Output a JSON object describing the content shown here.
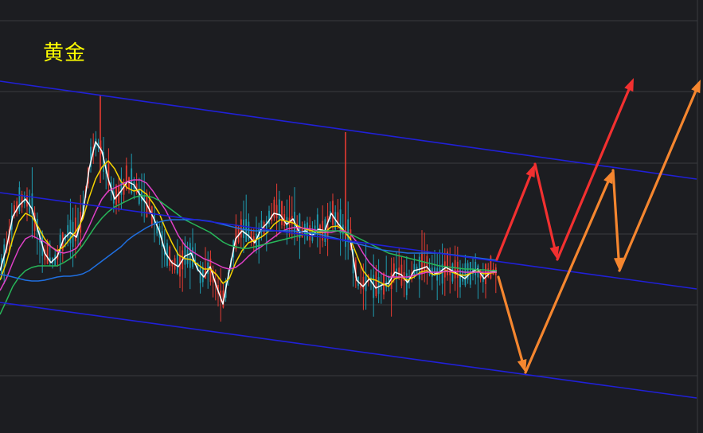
{
  "title": "黄金",
  "colors": {
    "background": "#1c1d21",
    "grid": "#3a3b40",
    "up": "#e53b32",
    "down": "#1e9bb0",
    "title": "#ffff00",
    "channel": "#2020d8",
    "arrow_red": "#f23030",
    "arrow_orange": "#f5862f"
  },
  "chart_data": {
    "type": "candlestick",
    "title": "黄金",
    "grid": true,
    "ylim": [
      0,
      544
    ],
    "series": [
      {
        "name": "",
        "color": "#ffffff",
        "kind": "ma",
        "x": [
          0,
          8,
          16,
          24,
          32,
          40,
          48,
          56,
          64,
          72,
          80,
          88,
          96,
          104,
          112,
          120,
          128,
          136,
          144,
          152,
          160,
          168,
          176,
          184,
          192,
          200,
          208,
          216,
          224,
          232,
          240,
          248,
          256,
          264,
          272,
          280,
          288,
          296,
          304,
          312,
          320,
          328,
          336,
          344,
          352,
          360,
          368,
          376,
          384,
          392,
          400,
          408,
          416,
          424,
          432,
          440,
          448,
          456,
          464,
          472,
          480,
          488,
          496,
          504,
          512,
          520,
          528,
          536,
          544,
          552,
          560,
          568,
          576,
          584,
          592,
          600,
          608,
          616,
          624
        ],
        "y": [
          340,
          312,
          272,
          258,
          250,
          262,
          290,
          318,
          330,
          322,
          300,
          292,
          298,
          270,
          212,
          178,
          190,
          225,
          250,
          240,
          228,
          232,
          245,
          256,
          272,
          290,
          318,
          330,
          335,
          322,
          318,
          338,
          348,
          335,
          360,
          382,
          340,
          300,
          290,
          296,
          305,
          288,
          280,
          268,
          270,
          282,
          275,
          292,
          290,
          296,
          288,
          290,
          268,
          280,
          290,
          300,
          352,
          360,
          350,
          362,
          358,
          356,
          342,
          345,
          355,
          340,
          338,
          335,
          345,
          342,
          336,
          340,
          345,
          350,
          342,
          338,
          350,
          342,
          340
        ]
      },
      {
        "name": "",
        "color": "#f5d300",
        "kind": "ma",
        "x": [
          0,
          8,
          16,
          24,
          32,
          40,
          48,
          56,
          64,
          72,
          80,
          88,
          96,
          104,
          112,
          120,
          128,
          136,
          144,
          152,
          160,
          168,
          176,
          184,
          192,
          200,
          208,
          216,
          224,
          232,
          240,
          248,
          256,
          264,
          272,
          280,
          288,
          296,
          304,
          312,
          320,
          328,
          336,
          344,
          352,
          360,
          368,
          376,
          384,
          392,
          400,
          408,
          416,
          424,
          432,
          440,
          448,
          456,
          464,
          472,
          480,
          488,
          496,
          504,
          512,
          520,
          528,
          536,
          544,
          552,
          560,
          568,
          576,
          584,
          592,
          600,
          608,
          616,
          624
        ],
        "y": [
          352,
          330,
          300,
          278,
          268,
          272,
          285,
          300,
          310,
          315,
          310,
          300,
          290,
          275,
          248,
          225,
          210,
          202,
          212,
          228,
          236,
          240,
          238,
          244,
          255,
          268,
          288,
          305,
          320,
          325,
          326,
          332,
          338,
          338,
          345,
          356,
          350,
          330,
          315,
          305,
          302,
          298,
          292,
          282,
          276,
          278,
          280,
          285,
          288,
          290,
          292,
          292,
          285,
          284,
          290,
          300,
          320,
          340,
          350,
          352,
          356,
          360,
          350,
          348,
          352,
          348,
          342,
          340,
          345,
          344,
          340,
          342,
          345,
          346,
          343,
          341,
          344,
          343,
          342
        ]
      },
      {
        "name": "",
        "color": "#e040c8",
        "kind": "ma",
        "x": [
          0,
          8,
          16,
          24,
          32,
          40,
          48,
          56,
          64,
          72,
          80,
          88,
          96,
          104,
          112,
          120,
          128,
          136,
          144,
          152,
          160,
          168,
          176,
          184,
          192,
          200,
          208,
          216,
          224,
          232,
          240,
          248,
          256,
          264,
          272,
          280,
          288,
          296,
          304,
          312,
          320,
          328,
          336,
          344,
          352,
          360,
          368,
          376,
          384,
          392,
          400,
          408,
          416,
          424,
          432,
          440,
          448,
          456,
          464,
          472,
          480,
          488,
          496,
          504,
          512,
          520,
          528,
          536,
          544,
          552,
          560,
          568,
          576,
          584,
          592,
          600,
          608,
          616,
          624
        ],
        "y": [
          365,
          350,
          330,
          312,
          300,
          296,
          300,
          304,
          310,
          316,
          318,
          316,
          312,
          300,
          284,
          266,
          250,
          240,
          236,
          232,
          228,
          226,
          226,
          230,
          240,
          252,
          264,
          280,
          296,
          308,
          315,
          320,
          325,
          328,
          332,
          336,
          338,
          336,
          330,
          322,
          315,
          310,
          304,
          298,
          292,
          288,
          286,
          286,
          287,
          288,
          290,
          292,
          292,
          290,
          290,
          294,
          304,
          318,
          330,
          338,
          344,
          348,
          348,
          348,
          348,
          346,
          344,
          342,
          342,
          342,
          341,
          341,
          341,
          342,
          342,
          342,
          342,
          342,
          342
        ]
      },
      {
        "name": "",
        "color": "#27b85a",
        "kind": "ma",
        "x": [
          0,
          8,
          16,
          24,
          32,
          40,
          48,
          56,
          64,
          72,
          80,
          88,
          96,
          104,
          112,
          120,
          128,
          136,
          144,
          152,
          160,
          168,
          176,
          184,
          192,
          200,
          208,
          216,
          224,
          232,
          240,
          248,
          256,
          264,
          272,
          280,
          288,
          296,
          304,
          312,
          320,
          328,
          336,
          344,
          352,
          360,
          368,
          376,
          384,
          392,
          400,
          408,
          416,
          424,
          432,
          440,
          448,
          456,
          464,
          472,
          480,
          488,
          496,
          504,
          512,
          520,
          528,
          536,
          544,
          552,
          560,
          568,
          576,
          584,
          592,
          600,
          608,
          616,
          624
        ],
        "y": [
          395,
          378,
          360,
          348,
          340,
          336,
          334,
          334,
          334,
          334,
          330,
          325,
          318,
          308,
          296,
          284,
          274,
          266,
          260,
          256,
          252,
          248,
          246,
          246,
          248,
          252,
          258,
          264,
          270,
          276,
          280,
          284,
          288,
          292,
          298,
          304,
          308,
          310,
          312,
          312,
          310,
          308,
          306,
          304,
          302,
          300,
          298,
          296,
          294,
          292,
          290,
          290,
          290,
          290,
          292,
          294,
          298,
          302,
          306,
          310,
          314,
          318,
          320,
          322,
          324,
          326,
          328,
          330,
          332,
          334,
          335,
          336,
          337,
          338,
          338,
          339,
          339,
          340,
          340
        ]
      },
      {
        "name": "",
        "color": "#1f6fe0",
        "kind": "ma",
        "x": [
          0,
          8,
          16,
          24,
          32,
          40,
          48,
          56,
          64,
          72,
          80,
          88,
          96,
          104,
          112,
          120,
          128,
          136,
          144,
          152,
          160,
          168,
          176,
          184,
          192,
          200,
          208,
          216,
          224,
          232,
          240,
          248,
          256,
          264,
          272,
          280,
          288,
          296,
          304,
          312,
          320,
          328,
          336,
          344,
          352,
          360,
          368,
          376,
          384,
          392,
          400,
          408,
          416,
          424,
          432,
          440,
          448,
          456,
          464,
          472,
          480,
          488,
          496,
          504,
          512,
          520,
          528,
          536,
          544,
          552,
          560,
          568,
          576,
          584,
          592,
          600,
          608,
          616,
          624
        ],
        "y": [
          345,
          346,
          348,
          350,
          352,
          353,
          353,
          352,
          350,
          348,
          347,
          347,
          346,
          344,
          340,
          334,
          328,
          322,
          316,
          310,
          302,
          296,
          291,
          286,
          282,
          279,
          277,
          276,
          276,
          276,
          276,
          276,
          277,
          278,
          280,
          282,
          284,
          286,
          288,
          289,
          290,
          290,
          290,
          290,
          290,
          290,
          290,
          291,
          292,
          293,
          294,
          296,
          298,
          300,
          302,
          304,
          306,
          308,
          310,
          312,
          314,
          315,
          316,
          317,
          318,
          318,
          318,
          318,
          318,
          318,
          319,
          320,
          321,
          322,
          323,
          324,
          325,
          326,
          327
        ]
      }
    ],
    "channels": [
      {
        "name": "upper",
        "x": [
          0,
          875
        ],
        "y": [
          102,
          225
        ]
      },
      {
        "name": "middle",
        "x": [
          0,
          875
        ],
        "y": [
          242,
          363
        ]
      },
      {
        "name": "lower",
        "x": [
          0,
          875
        ],
        "y": [
          380,
          500
        ]
      }
    ],
    "annotations": [
      {
        "kind": "arrow",
        "color": "#f23030",
        "points": [
          [
            624,
            326
          ],
          [
            672,
            206
          ]
        ]
      },
      {
        "kind": "arrow",
        "color": "#f23030",
        "points": [
          [
            672,
            206
          ],
          [
            700,
            326
          ]
        ]
      },
      {
        "kind": "arrow",
        "color": "#f23030",
        "points": [
          [
            700,
            326
          ],
          [
            796,
            98
          ]
        ]
      },
      {
        "kind": "arrow",
        "color": "#f5862f",
        "points": [
          [
            626,
            348
          ],
          [
            660,
            468
          ]
        ]
      },
      {
        "kind": "arrow",
        "color": "#f5862f",
        "points": [
          [
            660,
            468
          ],
          [
            770,
            214
          ]
        ]
      },
      {
        "kind": "arrow",
        "color": "#f5862f",
        "points": [
          [
            770,
            214
          ],
          [
            778,
            340
          ]
        ]
      },
      {
        "kind": "arrow",
        "color": "#f5862f",
        "points": [
          [
            778,
            340
          ],
          [
            880,
            100
          ]
        ]
      }
    ]
  }
}
